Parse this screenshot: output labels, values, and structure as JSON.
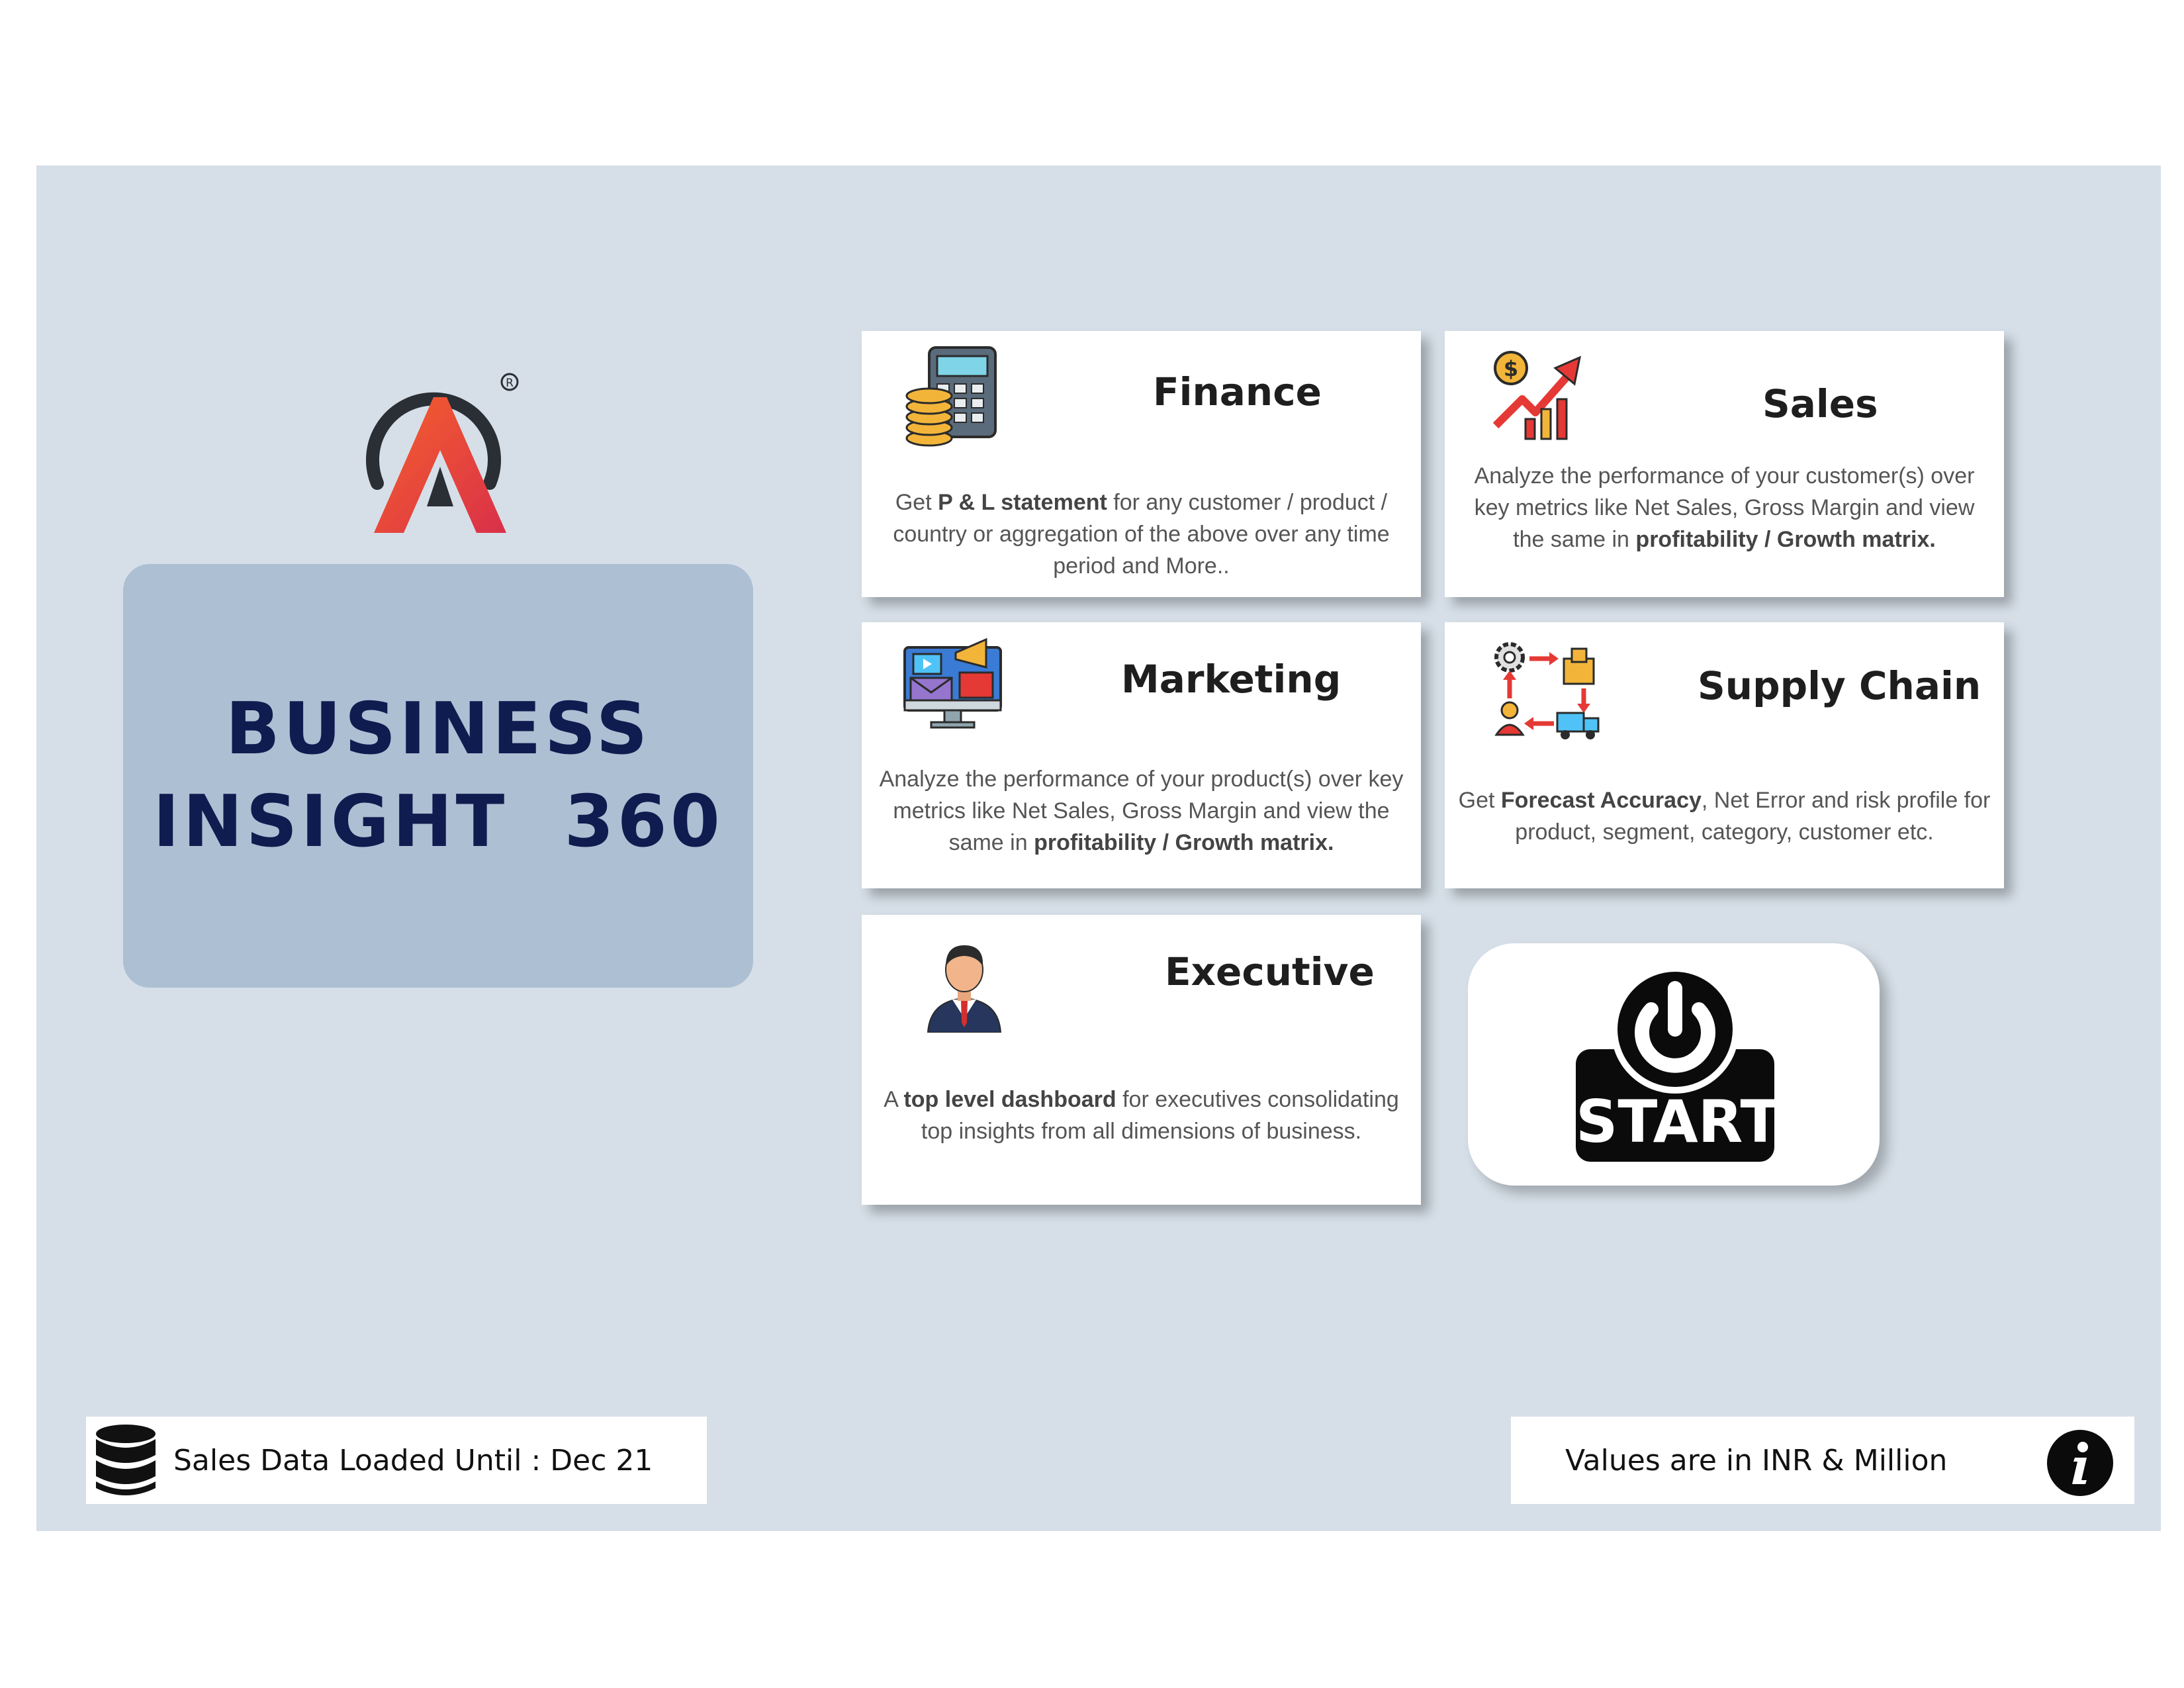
{
  "title": {
    "line1": "BUSINESS",
    "line2": "INSIGHT  360"
  },
  "cards": [
    {
      "id": "finance",
      "title": "Finance",
      "icon": "calculator-coins-icon",
      "desc": [
        {
          "t": "Get  "
        },
        {
          "t": "P & L statement",
          "b": true
        },
        {
          "t": " for any customer / product / country or aggregation of the above over any time period and More.."
        }
      ]
    },
    {
      "id": "sales",
      "title": "Sales",
      "icon": "sales-growth-chart-icon",
      "desc": [
        {
          "t": "Analyze the performance of your customer(s) over key metrics like Net Sales, Gross Margin and view the same in "
        },
        {
          "t": "profitability / Growth matrix.",
          "b": true
        }
      ]
    },
    {
      "id": "marketing",
      "title": "Marketing",
      "icon": "marketing-monitor-icon",
      "desc": [
        {
          "t": "Analyze the performance of your product(s) over key metrics like Net Sales, Gross Margin and view the same in "
        },
        {
          "t": "profitability / Growth matrix.",
          "b": true
        }
      ]
    },
    {
      "id": "supply-chain",
      "title": "Supply Chain",
      "icon": "supply-chain-icon",
      "desc": [
        {
          "t": "Get "
        },
        {
          "t": "Forecast Accuracy",
          "b": true
        },
        {
          "t": ", Net Error and risk profile for product, segment, category, customer etc."
        }
      ]
    },
    {
      "id": "executive",
      "title": "Executive",
      "icon": "businessman-icon",
      "desc": [
        {
          "t": "A "
        },
        {
          "t": "top level dashboard",
          "b": true
        },
        {
          "t": " for executives consolidating top insights from all dimensions of business."
        }
      ]
    }
  ],
  "start_button": {
    "label": "START",
    "icon": "power-icon"
  },
  "footer": {
    "data_loaded": "Sales Data Loaded Until : Dec 21",
    "data_icon": "database-icon",
    "units": "Values are in INR & Million",
    "info_icon": "info-icon"
  },
  "colors": {
    "panel_bg": "#d6dfe8",
    "title_box_bg": "#adbfd3",
    "title_text": "#0f1c4f",
    "logo_gradient_start": "#f5612b",
    "logo_gradient_end": "#d9304a",
    "logo_ring": "#2a2e35"
  }
}
